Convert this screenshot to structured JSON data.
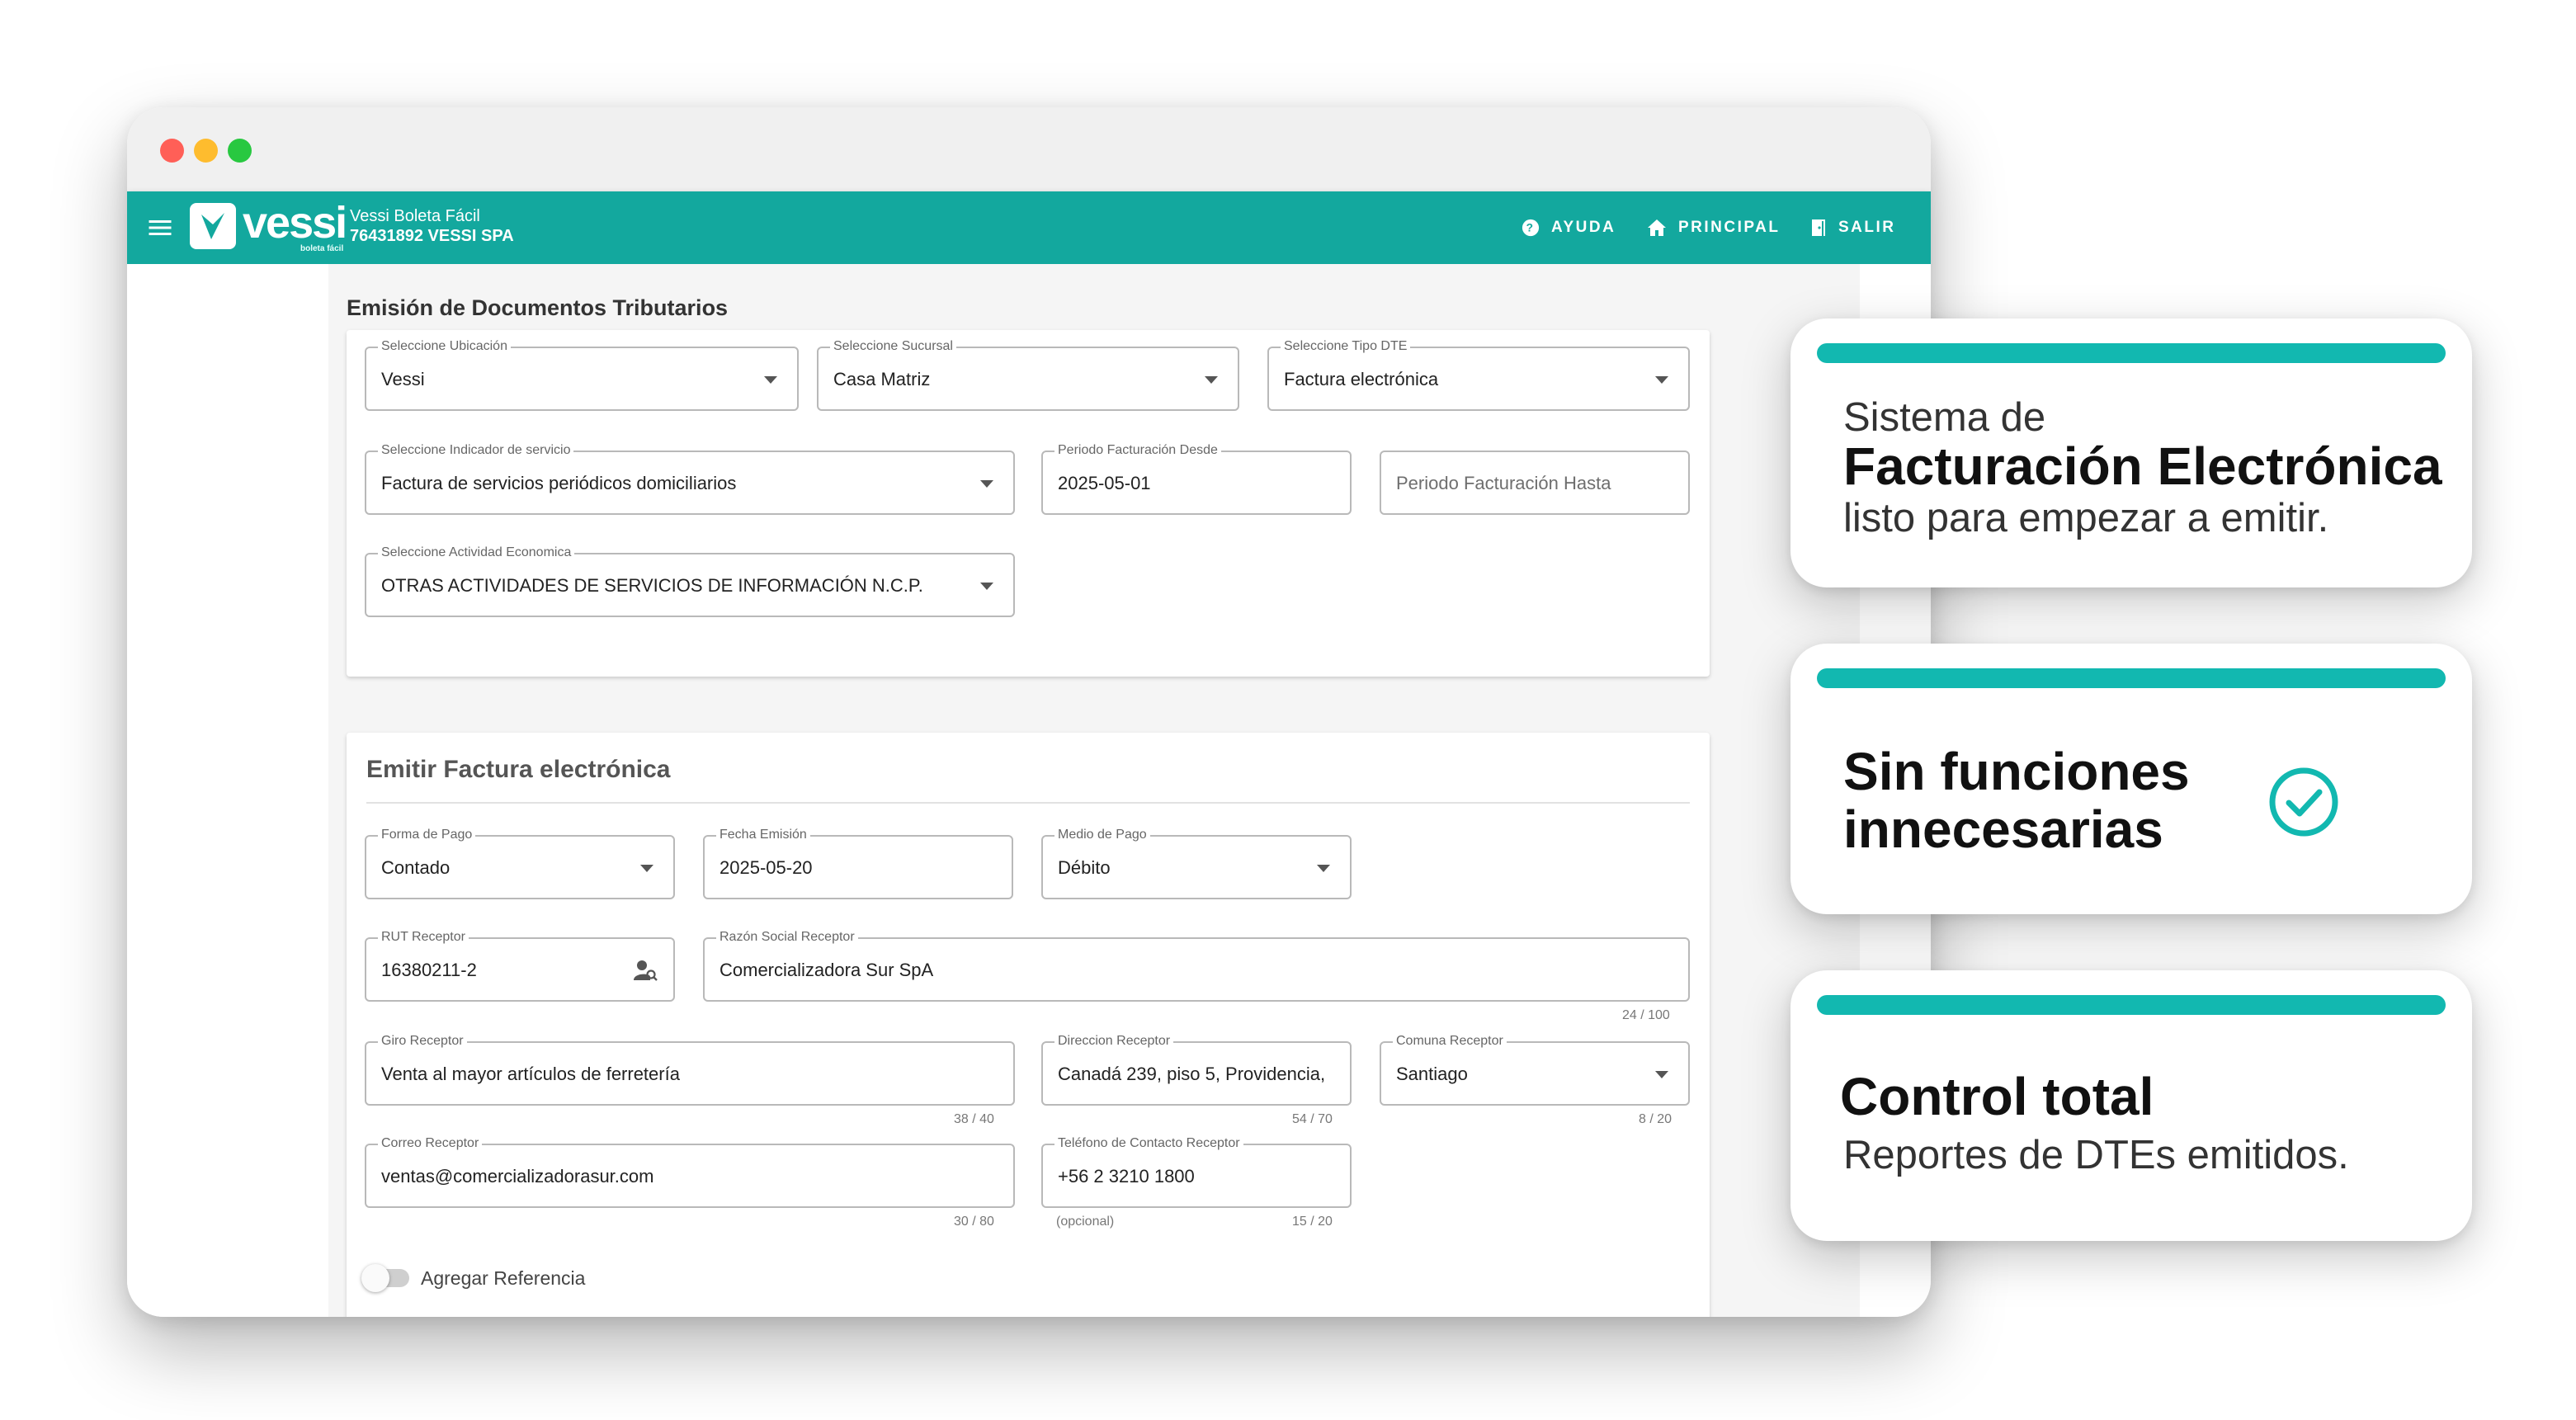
{
  "appbar": {
    "logo_text": "vessi",
    "logo_sub": "boleta fácil",
    "app_name": "Vessi Boleta Fácil",
    "company": "76431892 VESSI SPA",
    "nav": [
      {
        "label": "AYUDA",
        "icon": "help-icon"
      },
      {
        "label": "PRINCIPAL",
        "icon": "home-icon"
      },
      {
        "label": "SALIR",
        "icon": "exit-icon"
      }
    ],
    "color": "#13a89e"
  },
  "emision": {
    "title": "Emisión de Documentos Tributarios",
    "ubicacion": {
      "label": "Seleccione Ubicación",
      "value": "Vessi"
    },
    "sucursal": {
      "label": "Seleccione Sucursal",
      "value": "Casa Matriz"
    },
    "tipo_dte": {
      "label": "Seleccione Tipo DTE",
      "value": "Factura electrónica"
    },
    "indicador": {
      "label": "Seleccione Indicador de servicio",
      "value": "Factura de servicios periódicos domiciliarios"
    },
    "periodo_desde": {
      "label": "Periodo Facturación Desde",
      "value": "2025-05-01"
    },
    "periodo_hasta": {
      "placeholder": "Periodo Facturación Hasta"
    },
    "actividad": {
      "label": "Seleccione Actividad Economica",
      "value": "OTRAS ACTIVIDADES DE SERVICIOS DE INFORMACIÓN N.C.P."
    }
  },
  "factura": {
    "title": "Emitir Factura electrónica",
    "forma_pago": {
      "label": "Forma de Pago",
      "value": "Contado"
    },
    "fecha_emision": {
      "label": "Fecha Emisión",
      "value": "2025-05-20"
    },
    "medio_pago": {
      "label": "Medio de Pago",
      "value": "Débito"
    },
    "rut": {
      "label": "RUT Receptor",
      "value": "16380211-2"
    },
    "razon_social": {
      "label": "Razón Social Receptor",
      "value": "Comercializadora Sur SpA",
      "counter": "24 / 100"
    },
    "giro": {
      "label": "Giro Receptor",
      "value": "Venta al mayor artículos de ferretería",
      "counter": "38 / 40"
    },
    "direccion": {
      "label": "Direccion Receptor",
      "value": "Canadá 239, piso 5, Providencia,",
      "counter": "54 / 70"
    },
    "comuna": {
      "label": "Comuna Receptor",
      "value": "Santiago",
      "counter": "8 / 20"
    },
    "correo": {
      "label": "Correo Receptor",
      "value": "ventas@comercializadorasur.com",
      "counter": "30 / 80"
    },
    "telefono": {
      "label": "Teléfono de Contacto Receptor",
      "value": "+56 2 3210 1800",
      "counter": "15 / 20",
      "helper": "(opcional)"
    },
    "referencia_label": "Agregar Referencia"
  },
  "promos": [
    {
      "line1": "Sistema de",
      "line2": "Facturación Electrónica",
      "line3": "listo para empezar a emitir."
    },
    {
      "line1": "Sin funciones",
      "line2": "innecesarias",
      "icon": "check-circle-icon"
    },
    {
      "line1": "Control total",
      "line2": "Reportes de DTEs emitidos."
    }
  ],
  "accent": "#12b8b0"
}
